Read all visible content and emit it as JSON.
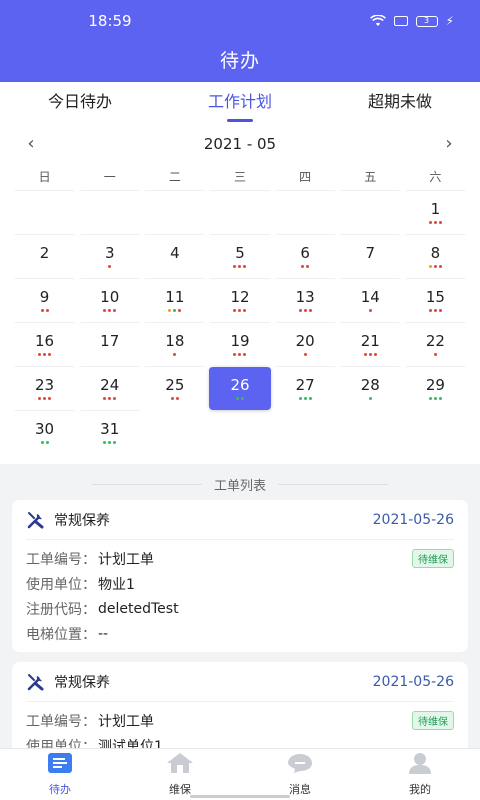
{
  "status": {
    "time": "18:59",
    "battery": "3"
  },
  "header": {
    "title": "待办"
  },
  "tabs": [
    {
      "label": "今日待办",
      "active": false
    },
    {
      "label": "工作计划",
      "active": true
    },
    {
      "label": "超期未做",
      "active": false
    }
  ],
  "calendar": {
    "month_label": "2021 - 05",
    "weekdays": [
      "日",
      "一",
      "二",
      "三",
      "四",
      "五",
      "六"
    ],
    "leading_blanks": 6,
    "selected_day": 26,
    "dot_colors": {
      "r": "#e0463f",
      "o": "#f0a020",
      "g": "#2fbf5a"
    },
    "days": [
      {
        "d": "1",
        "dots": "rrr"
      },
      {
        "d": "2",
        "dots": ""
      },
      {
        "d": "3",
        "dots": "r"
      },
      {
        "d": "4",
        "dots": ""
      },
      {
        "d": "5",
        "dots": "rrr"
      },
      {
        "d": "6",
        "dots": "rr"
      },
      {
        "d": "7",
        "dots": ""
      },
      {
        "d": "8",
        "dots": "orr"
      },
      {
        "d": "9",
        "dots": "rr"
      },
      {
        "d": "10",
        "dots": "rrr"
      },
      {
        "d": "11",
        "dots": "ogr"
      },
      {
        "d": "12",
        "dots": "rrr"
      },
      {
        "d": "13",
        "dots": "rrr"
      },
      {
        "d": "14",
        "dots": "r"
      },
      {
        "d": "15",
        "dots": "rrr"
      },
      {
        "d": "16",
        "dots": "rrr"
      },
      {
        "d": "17",
        "dots": ""
      },
      {
        "d": "18",
        "dots": "r"
      },
      {
        "d": "19",
        "dots": "rrr"
      },
      {
        "d": "20",
        "dots": "r"
      },
      {
        "d": "21",
        "dots": "rrr"
      },
      {
        "d": "22",
        "dots": "r"
      },
      {
        "d": "23",
        "dots": "rrr"
      },
      {
        "d": "24",
        "dots": "rrr"
      },
      {
        "d": "25",
        "dots": "rr"
      },
      {
        "d": "26",
        "dots": "gg"
      },
      {
        "d": "27",
        "dots": "ggg"
      },
      {
        "d": "28",
        "dots": "g"
      },
      {
        "d": "29",
        "dots": "ggg"
      },
      {
        "d": "30",
        "dots": "gg"
      },
      {
        "d": "31",
        "dots": "ggg"
      }
    ]
  },
  "list": {
    "title": "工单列表",
    "cards": [
      {
        "type": "常规保养",
        "date": "2021-05-26",
        "badge": "待维保",
        "rows": [
          {
            "label": "工单编号：",
            "value": "计划工单"
          },
          {
            "label": "使用单位：",
            "value": "物业1"
          },
          {
            "label": "注册代码：",
            "value": "deletedTest"
          },
          {
            "label": "电梯位置：",
            "value": "--"
          }
        ]
      },
      {
        "type": "常规保养",
        "date": "2021-05-26",
        "badge": "待维保",
        "rows": [
          {
            "label": "工单编号：",
            "value": "计划工单"
          },
          {
            "label": "使用单位：",
            "value": "测试单位1"
          }
        ]
      }
    ]
  },
  "tabbar": [
    {
      "label": "待办",
      "icon": "todo-list-icon",
      "active": true
    },
    {
      "label": "维保",
      "icon": "home-icon",
      "active": false
    },
    {
      "label": "消息",
      "icon": "message-icon",
      "active": false
    },
    {
      "label": "我的",
      "icon": "user-icon",
      "active": false
    }
  ]
}
